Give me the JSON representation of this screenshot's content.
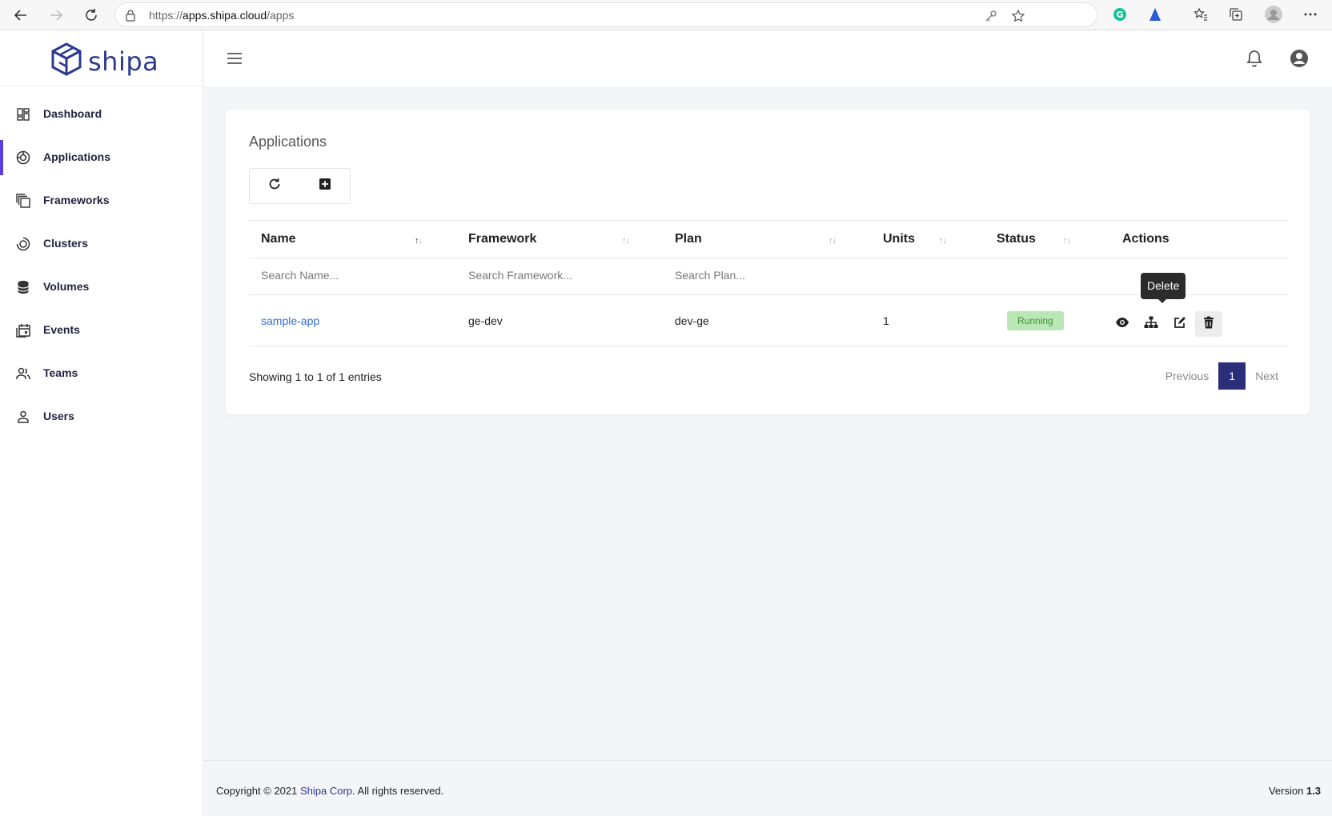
{
  "browser": {
    "url_prefix": "https://",
    "url_host": "apps.shipa.cloud",
    "url_path": "/apps"
  },
  "brand": {
    "name": "shipa",
    "color": "#2b3990"
  },
  "sidebar": {
    "items": [
      {
        "label": "Dashboard",
        "icon": "dashboard-icon",
        "active": false
      },
      {
        "label": "Applications",
        "icon": "applications-icon",
        "active": true
      },
      {
        "label": "Frameworks",
        "icon": "frameworks-icon",
        "active": false
      },
      {
        "label": "Clusters",
        "icon": "clusters-icon",
        "active": false
      },
      {
        "label": "Volumes",
        "icon": "volumes-icon",
        "active": false
      },
      {
        "label": "Events",
        "icon": "events-icon",
        "active": false
      },
      {
        "label": "Teams",
        "icon": "teams-icon",
        "active": false
      },
      {
        "label": "Users",
        "icon": "users-icon",
        "active": false
      }
    ],
    "active_color": "#5b3fd6"
  },
  "main": {
    "title": "Applications",
    "table": {
      "columns": [
        "Name",
        "Framework",
        "Plan",
        "Units",
        "Status",
        "Actions"
      ],
      "filters": {
        "name_placeholder": "Search Name...",
        "framework_placeholder": "Search Framework...",
        "plan_placeholder": "Search Plan..."
      },
      "rows": [
        {
          "name": "sample-app",
          "framework": "ge-dev",
          "plan": "dev-ge",
          "units": "1",
          "status": "Running"
        }
      ],
      "status_color": "#b9e7b5"
    },
    "tooltip": "Delete",
    "showing": "Showing 1 to 1 of 1 entries",
    "pagination": {
      "previous": "Previous",
      "current": "1",
      "next": "Next"
    }
  },
  "footer": {
    "copyright_prefix": "Copyright © 2021 ",
    "company": "Shipa Corp",
    "copyright_suffix": ". All rights reserved.",
    "version_label": "Version ",
    "version": "1.3"
  }
}
